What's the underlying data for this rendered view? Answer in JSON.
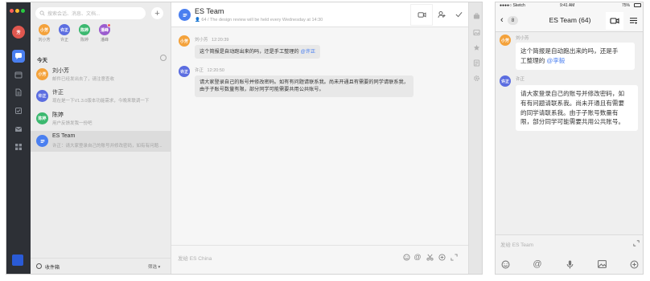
{
  "desktop": {
    "search": {
      "placeholder": "搜索会话、消息、文档..."
    },
    "add_label": "+",
    "favorites": [
      {
        "avatar_text": "小芳",
        "name": "刘小芳",
        "color": "#f4a23b"
      },
      {
        "avatar_text": "许正",
        "name": "许正",
        "color": "#5b6de0"
      },
      {
        "avatar_text": "陈婷",
        "name": "陈婷",
        "color": "#3bb86f"
      },
      {
        "avatar_text": "潘峰",
        "name": "潘峰",
        "color": "#9b5ccf"
      }
    ],
    "section_today": "今天",
    "conversations": [
      {
        "name": "刘小芳",
        "preview": "邮件已经发出去了，请注意查收",
        "avatar_text": "小芳",
        "color": "#f4a23b"
      },
      {
        "name": "许正",
        "preview": "现在是一下V1.3.0版本功能需求，今晚来联调一下",
        "avatar_text": "许正",
        "color": "#5b6de0"
      },
      {
        "name": "陈婷",
        "preview": "用户反馈发我一份吧",
        "avatar_text": "陈婷",
        "color": "#3bb86f"
      },
      {
        "name": "ES Team",
        "preview": "许正：请大家登录自己的账号并修改密码，如有有问题...",
        "avatar_text": "",
        "color": "#4a7ff0"
      }
    ],
    "footer": {
      "inbox_label": "收件箱",
      "filter_label": "筛选 ▾"
    },
    "chat": {
      "title": "ES Team",
      "subtitle": "64  /  The design review will be held every Wednesday at 14:30",
      "messages": [
        {
          "sender": "刘小芳",
          "time": "12:20:39",
          "avatar_text": "小芳",
          "color": "#f4a23b",
          "text": "这个简报是自动跑出来的吗，还是手工整理的 ",
          "mention": "@许正"
        },
        {
          "sender": "许正",
          "time": "12:20:50",
          "avatar_text": "许正",
          "color": "#5b6de0",
          "line1": "请大家登录自己的账号并修改密码。如有有问题请联系我。尚未开通且有需要的同学请联系我，",
          "line2": "由于子账号数量有限，部分同学可能需要共用公共账号。"
        }
      ],
      "composer_placeholder": "发给 ES China"
    }
  },
  "mobile": {
    "status": {
      "carrier": "●●●●○ Sketch",
      "time": "9:41 AM",
      "battery": "75%"
    },
    "back_count": "8",
    "title": "ES Team  (64)",
    "messages": [
      {
        "sender": "刘小芳",
        "avatar_text": "小芳",
        "color": "#f4a23b",
        "line1": "这个简报是自动跑出来的吗，还是手",
        "line2_prefix": "工整理的 ",
        "mention": "@李毅"
      },
      {
        "sender": "许正",
        "avatar_text": "许正",
        "color": "#5b6de0",
        "lines": [
          "请大家登录自己的账号并修改密码，如",
          "有有问题请联系我。尚未开通且有需要",
          "的同学请联系我。由于子账号数量有",
          "限，部分同学可能需要共用公共账号。"
        ]
      }
    ],
    "composer_placeholder": "发给 ES Team"
  },
  "colors": {
    "accent": "#4a7ff0",
    "rail": "#2d3036"
  }
}
